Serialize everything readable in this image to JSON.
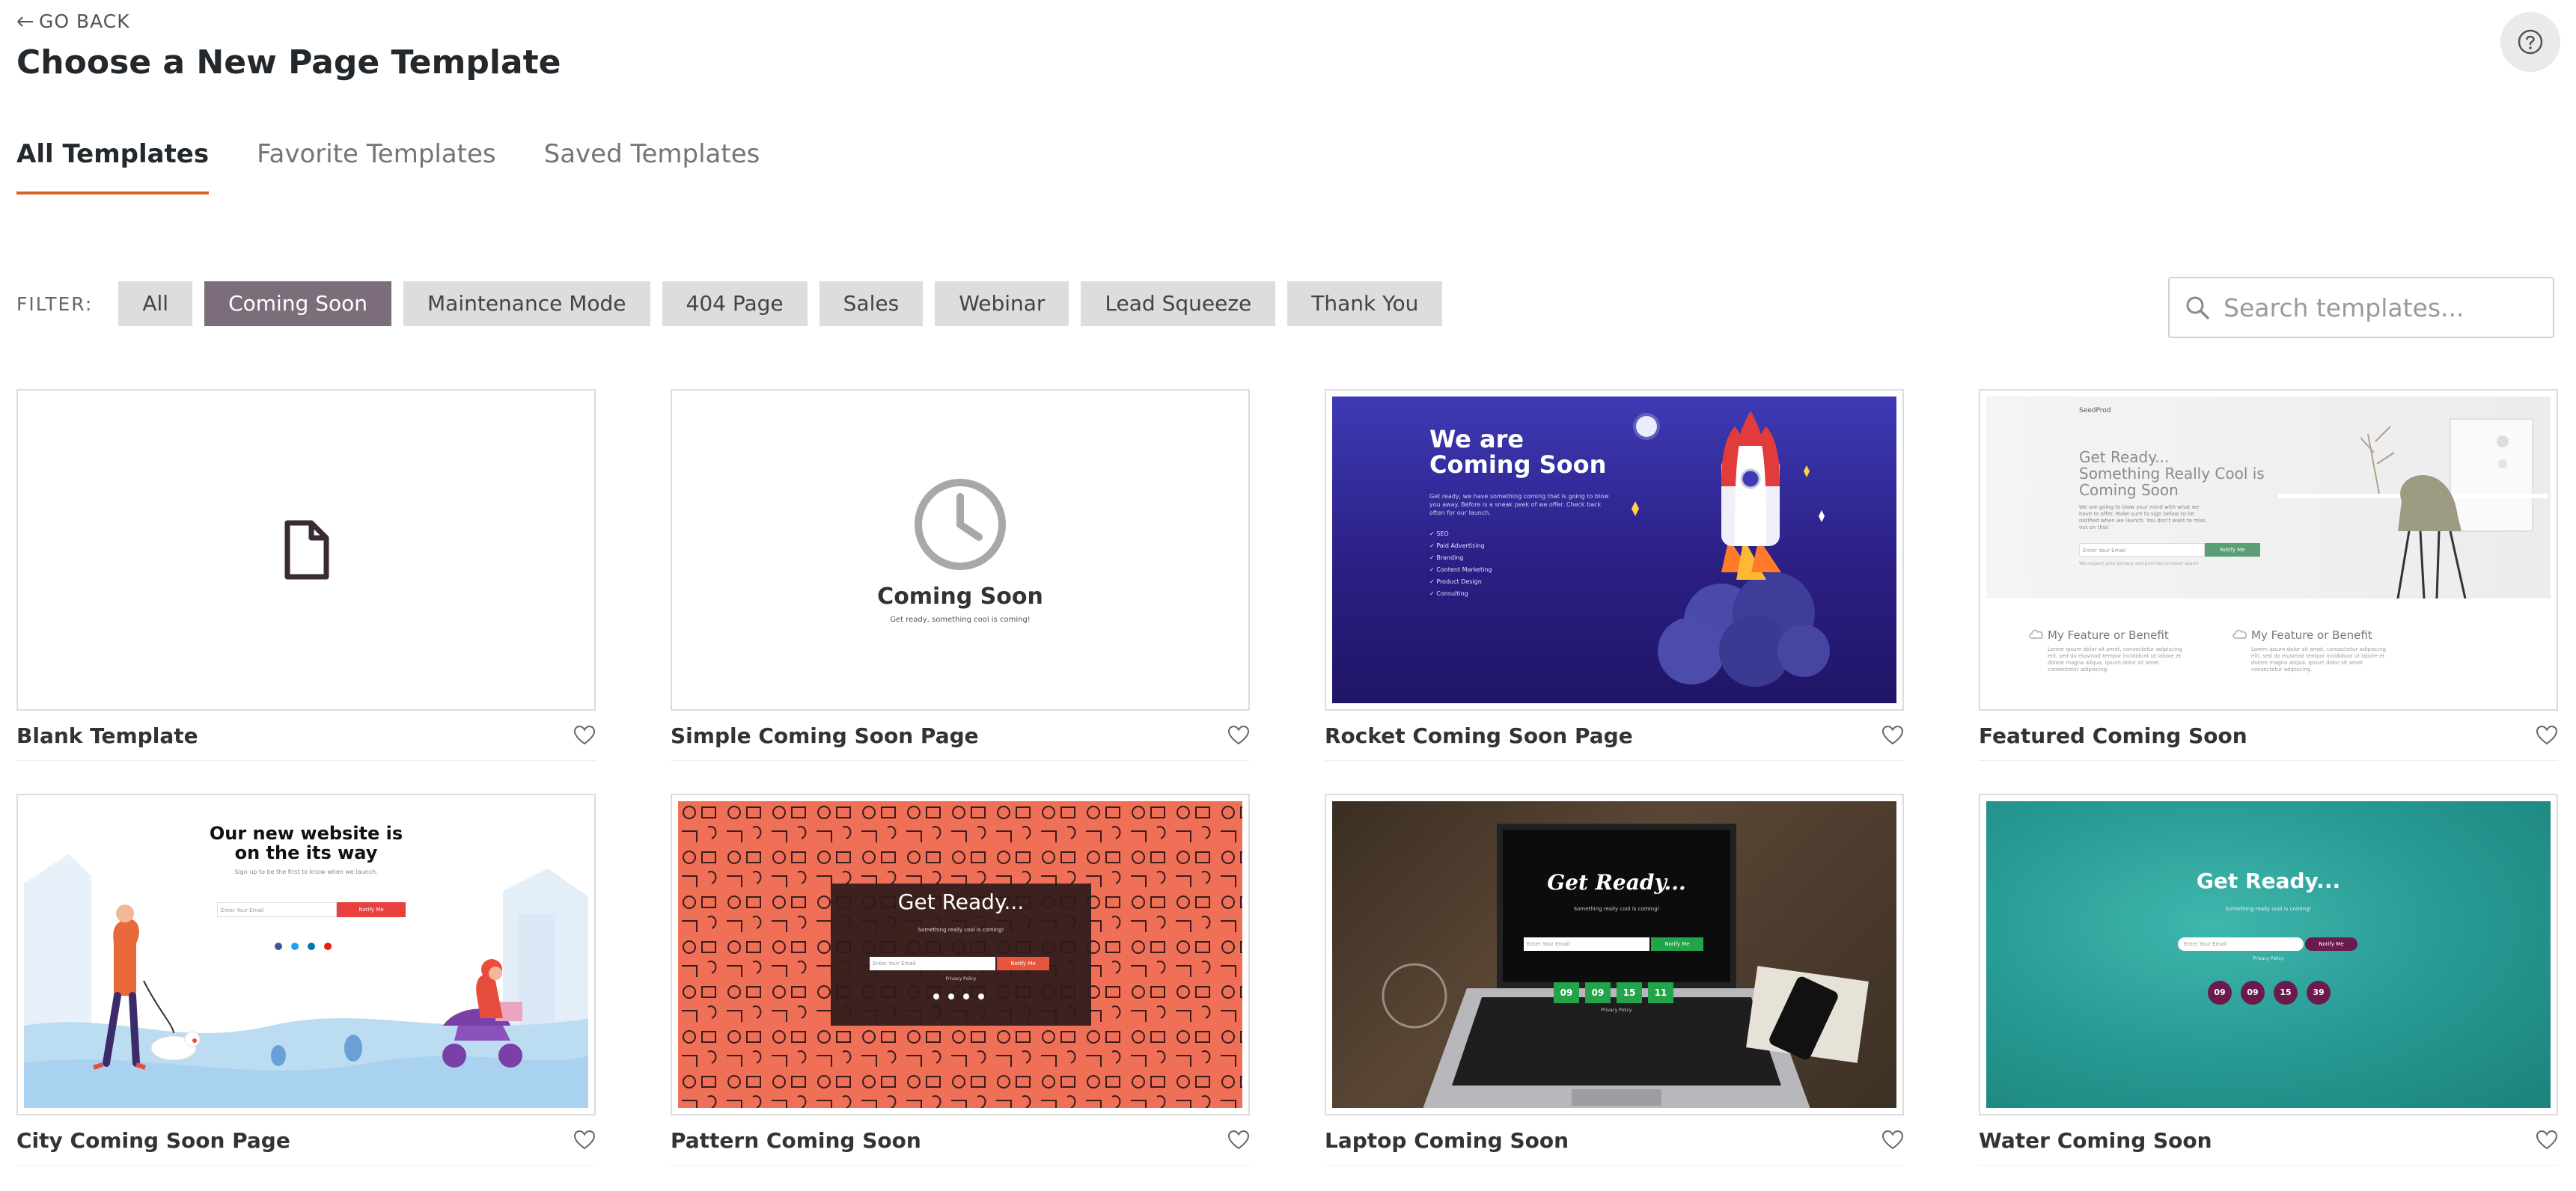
{
  "header": {
    "go_back": "GO BACK",
    "title": "Choose a New Page Template"
  },
  "tabs": [
    {
      "label": "All Templates",
      "active": true
    },
    {
      "label": "Favorite Templates",
      "active": false
    },
    {
      "label": "Saved Templates",
      "active": false
    }
  ],
  "filter": {
    "label": "FILTER:",
    "chips": [
      {
        "label": "All",
        "active": false
      },
      {
        "label": "Coming Soon",
        "active": true
      },
      {
        "label": "Maintenance Mode",
        "active": false
      },
      {
        "label": "404 Page",
        "active": false
      },
      {
        "label": "Sales",
        "active": false
      },
      {
        "label": "Webinar",
        "active": false
      },
      {
        "label": "Lead Squeeze",
        "active": false
      },
      {
        "label": "Thank You",
        "active": false
      }
    ]
  },
  "search": {
    "placeholder": "Search templates..."
  },
  "colors": {
    "accent": "#d6612a",
    "chip_active": "#7c6d7a",
    "chip": "#dddcdf"
  },
  "templates": [
    {
      "name": "Blank Template",
      "icon": "document-icon"
    },
    {
      "name": "Simple Coming Soon Page",
      "preview_title": "Coming Soon",
      "preview_sub": "Get ready, something cool is coming!"
    },
    {
      "name": "Rocket Coming Soon Page",
      "preview_title_1": "We are",
      "preview_title_2": "Coming Soon",
      "preview_text": "Get ready, we have something coming that is going to blow you away. Before is a sneak peek of we offer. Check back often for our launch.",
      "preview_list": [
        "SEO",
        "Paid Advertising",
        "Branding",
        "Content Marketing",
        "Product Design",
        "Consulting"
      ]
    },
    {
      "name": "Featured Coming Soon",
      "preview_brand": "SeedProd",
      "preview_title_1": "Get Ready...",
      "preview_title_2": "Something Really Cool is",
      "preview_title_3": "Coming Soon",
      "preview_text": "We are going to blow your mind with what we have to offer. Make sure to sign below to be notified when we launch. You don't want to miss out on this!",
      "preview_input": "Enter Your Email",
      "preview_button": "Notify Me",
      "preview_note": "We respect your privacy and promise to never spam!",
      "feature_title": "My Feature or Benefit",
      "feature_text": "Lorem ipsum dolor sit amet, consectetur adipiscing elit, sed do eiusmod tempor incididunt ut labore et dolore magna aliqua. Ipsum dolor sit amet consectetur adipiscing."
    },
    {
      "name": "City Coming Soon Page",
      "preview_title_1": "Our new website is",
      "preview_title_2": "on the its way",
      "preview_sub": "Sign up to be the first to know when we launch.",
      "preview_input": "Enter Your Email",
      "preview_button": "Notify Me"
    },
    {
      "name": "Pattern Coming Soon",
      "preview_title": "Get Ready...",
      "preview_sub": "Something really cool is coming!",
      "preview_input": "Enter Your Email",
      "preview_button": "Notify Me",
      "preview_policy": "Privacy Policy"
    },
    {
      "name": "Laptop Coming Soon",
      "preview_title": "Get Ready...",
      "preview_sub": "Something really cool is coming!",
      "preview_input": "Enter Your Email",
      "preview_button": "Notify Me",
      "preview_policy": "Privacy Policy",
      "countdown": [
        "09",
        "09",
        "15",
        "11"
      ]
    },
    {
      "name": "Water Coming Soon",
      "preview_title": "Get Ready...",
      "preview_sub": "Something really cool is coming!",
      "preview_input": "Enter Your Email",
      "preview_button": "Notify Me",
      "preview_policy": "Privacy Policy",
      "countdown": [
        "09",
        "09",
        "15",
        "39"
      ]
    }
  ]
}
